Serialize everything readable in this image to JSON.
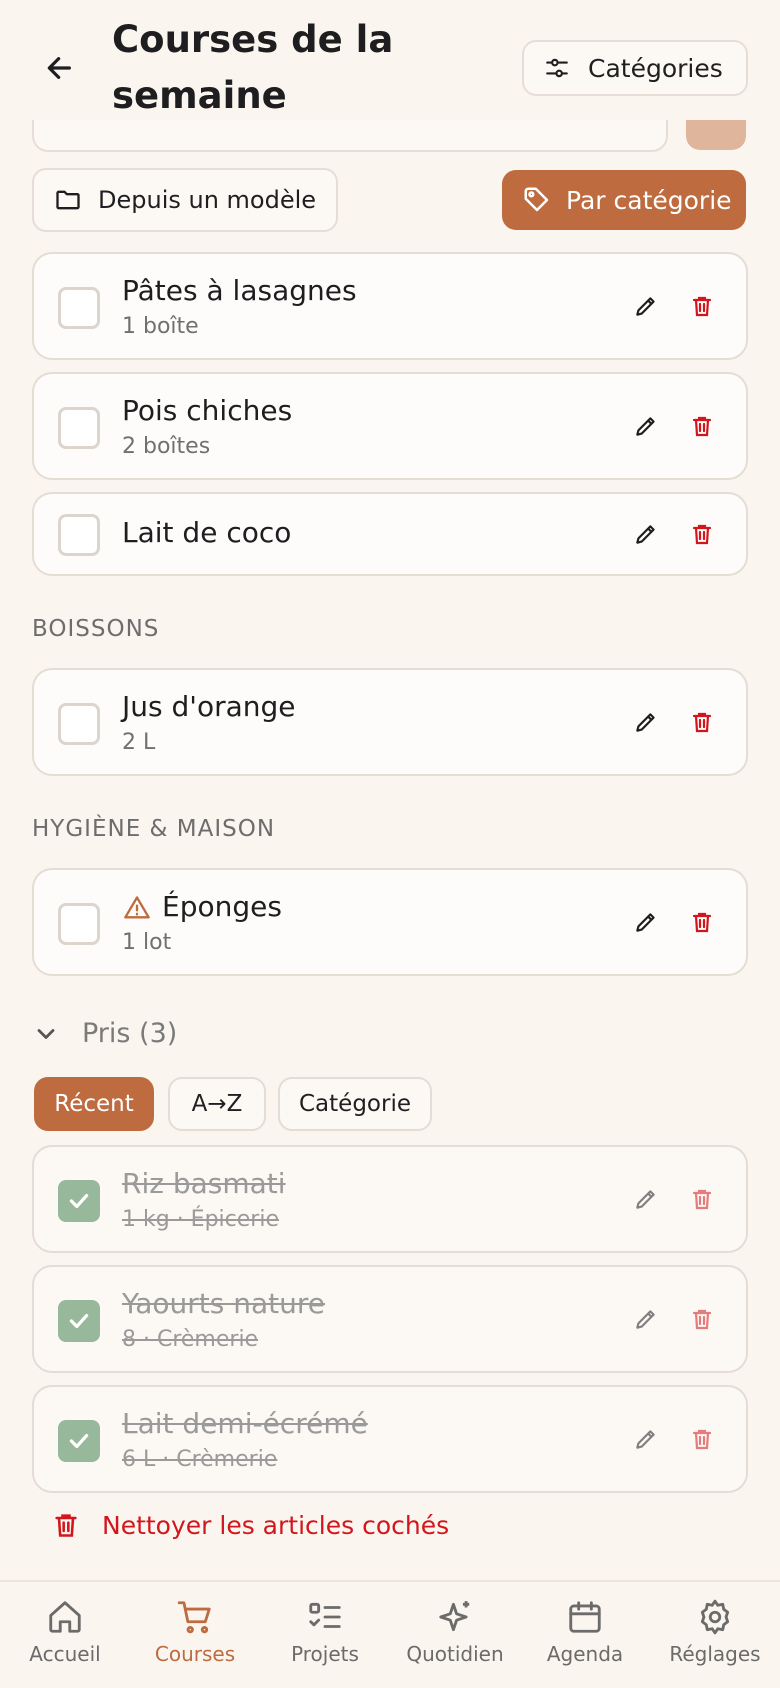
{
  "header": {
    "title": "Courses de la semaine",
    "categories_label": "Catégories"
  },
  "toolbar": {
    "template_label": "Depuis un modèle",
    "by_category_label": "Par catégorie"
  },
  "items_top": [
    {
      "name": "Pâtes à lasagnes",
      "sub": "1 boîte"
    },
    {
      "name": "Pois chiches",
      "sub": "2 boîtes"
    },
    {
      "name": "Lait de coco",
      "sub": ""
    }
  ],
  "section_boissons": {
    "label": "BOISSONS",
    "items": [
      {
        "name": "Jus d'orange",
        "sub": "2 L"
      }
    ]
  },
  "section_hygiene": {
    "label": "HYGIÈNE & MAISON",
    "items": [
      {
        "name": "Éponges",
        "sub": "1 lot",
        "warning": true
      }
    ]
  },
  "taken": {
    "label": "Pris (3)",
    "sort_options": [
      "Récent",
      "A→Z",
      "Catégorie"
    ],
    "selected_sort": "Récent",
    "items": [
      {
        "name": "Riz basmati",
        "sub": "1 kg · Épicerie"
      },
      {
        "name": "Yaourts nature",
        "sub": "8 · Crèmerie"
      },
      {
        "name": "Lait demi-écrémé",
        "sub": "6 L · Crèmerie"
      }
    ],
    "clean_label": "Nettoyer les articles cochés"
  },
  "nav": [
    {
      "label": "Accueil",
      "icon": "home-icon"
    },
    {
      "label": "Courses",
      "icon": "cart-icon",
      "active": true
    },
    {
      "label": "Projets",
      "icon": "checklist-icon"
    },
    {
      "label": "Quotidien",
      "icon": "sparkles-icon"
    },
    {
      "label": "Agenda",
      "icon": "calendar-icon"
    },
    {
      "label": "Réglages",
      "icon": "gear-icon"
    }
  ],
  "colors": {
    "accent": "#bd6b3f",
    "danger": "#d2161d",
    "checked": "#98b89c",
    "background": "#fbf5ef"
  }
}
